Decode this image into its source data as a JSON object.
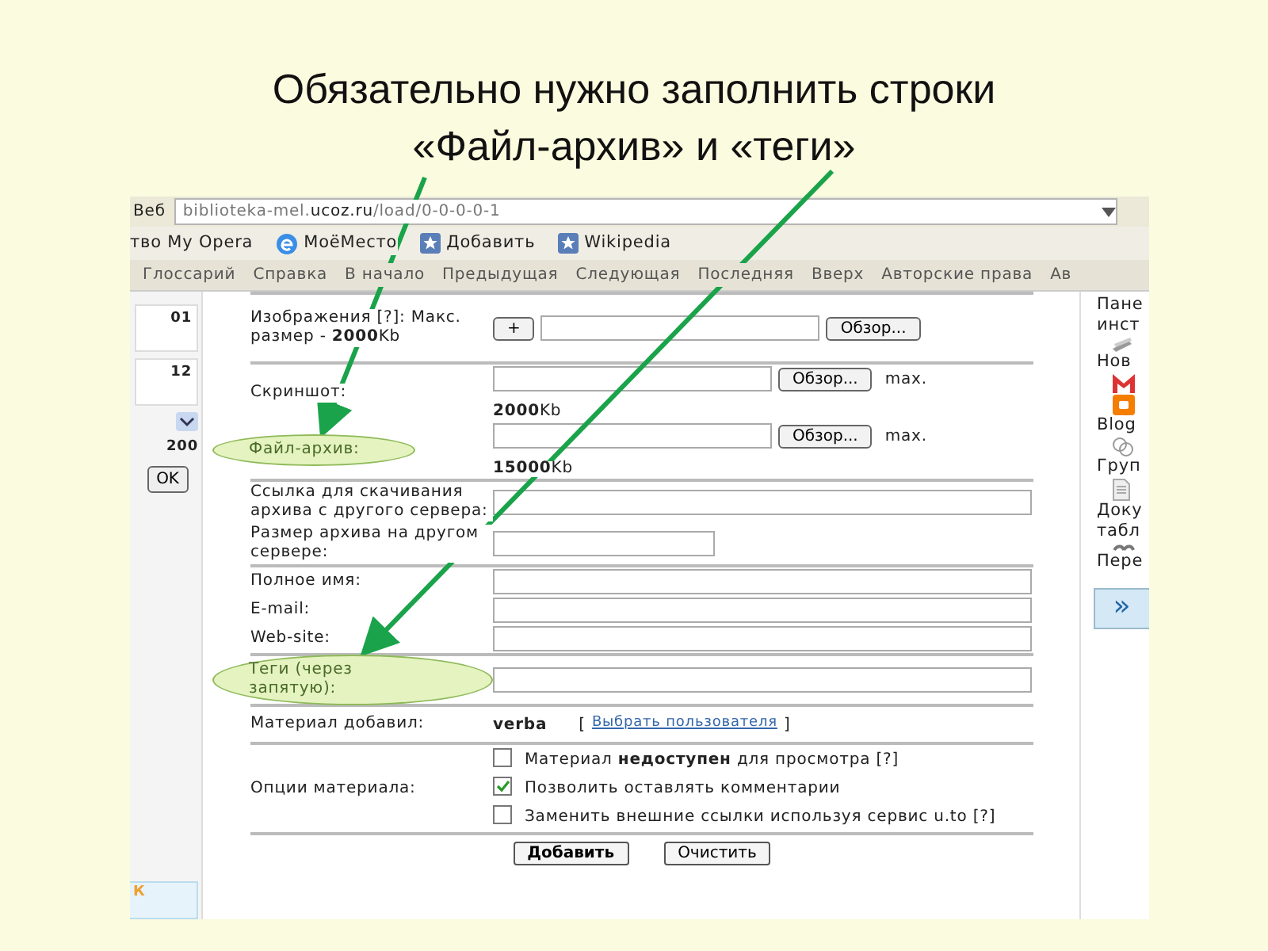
{
  "slide": {
    "title_lines": [
      "Обязательно нужно заполнить строки",
      "«Файл-архив» и «теги»"
    ]
  },
  "browser": {
    "search_engine": "Веб",
    "address": "biblioteka-mel.**ucoz.ru**/load/0-0-0-0-1",
    "bookmarks": [
      {
        "kind": "plain",
        "label": "тво My Opera"
      },
      {
        "kind": "globe",
        "label": "МоёМесто"
      },
      {
        "kind": "star",
        "label": "Добавить"
      },
      {
        "kind": "star",
        "label": "Wikipedia"
      }
    ],
    "nav_links": [
      "Глоссарий",
      "Справка",
      "В начало",
      "Предыдущая",
      "Следующая",
      "Последняя",
      "Вверх",
      "Авторские права",
      "Ав"
    ]
  },
  "left_panel": {
    "dates": [
      "01",
      "12"
    ],
    "count": "200",
    "ok_button": "OK",
    "footer": "К"
  },
  "form": {
    "sections": [
      [
        {
          "kind": "upload",
          "label": "Изображения [?]: Макс. размер - **2000**Kb",
          "add_button": "+",
          "browse": "Обзор...",
          "highlighted": false
        }
      ],
      [
        {
          "kind": "file",
          "label": "Скриншот:",
          "browse": "Обзор...",
          "note": "max.",
          "size": "**2000**Kb",
          "highlighted": false
        },
        {
          "kind": "file",
          "label": "Файл-архив:",
          "browse": "Обзор...",
          "note": "max.",
          "size": "**15000**Kb",
          "highlighted": true
        }
      ],
      [
        {
          "kind": "text",
          "label": "Ссылка для скачивания архива с другого сервера:",
          "short": false,
          "highlighted": false
        },
        {
          "kind": "text",
          "label": "Размер архива на другом сервере:",
          "short": true,
          "highlighted": false
        }
      ],
      [
        {
          "kind": "text",
          "label": "Полное имя:",
          "short": false,
          "highlighted": false
        },
        {
          "kind": "text",
          "label": "E-mail:",
          "short": false,
          "highlighted": false
        },
        {
          "kind": "text",
          "label": "Web-site:",
          "short": false,
          "highlighted": false
        }
      ],
      [
        {
          "kind": "text",
          "label": "Теги (через запятую):",
          "short": false,
          "highlighted": true
        }
      ],
      [
        {
          "kind": "static",
          "label": "Материал добавил:",
          "value": "verba",
          "bracket_open": "[",
          "link": "Выбрать пользователя",
          "bracket_close": "]",
          "highlighted": false
        }
      ],
      [
        {
          "kind": "options",
          "label": "Опции материала:",
          "highlighted": false,
          "options": [
            {
              "text": "Материал **недоступен** для просмотра [?]",
              "checked": false
            },
            {
              "text": "Позволить оставлять комментарии",
              "checked": true
            },
            {
              "text": "Заменить внешние ссылки используя сервис u.to [?]",
              "checked": false
            }
          ]
        }
      ]
    ],
    "buttons": [
      {
        "label": "Добавить",
        "primary": true
      },
      {
        "label": "Очистить",
        "primary": false
      }
    ]
  },
  "right_panel": [
    {
      "kind": "link",
      "text": "Пане"
    },
    {
      "kind": "link",
      "text": "инст"
    },
    {
      "kind": "books"
    },
    {
      "kind": "link",
      "text": "Нов"
    },
    {
      "kind": "mail"
    },
    {
      "kind": "blog"
    },
    {
      "kind": "link",
      "text": "Blog"
    },
    {
      "kind": "group"
    },
    {
      "kind": "link",
      "text": "Груп"
    },
    {
      "kind": "document"
    },
    {
      "kind": "link",
      "text": "Доку"
    },
    {
      "kind": "link",
      "text": "табл"
    },
    {
      "kind": "translate"
    },
    {
      "kind": "link",
      "text": "Пере"
    }
  ],
  "right_button": "»"
}
